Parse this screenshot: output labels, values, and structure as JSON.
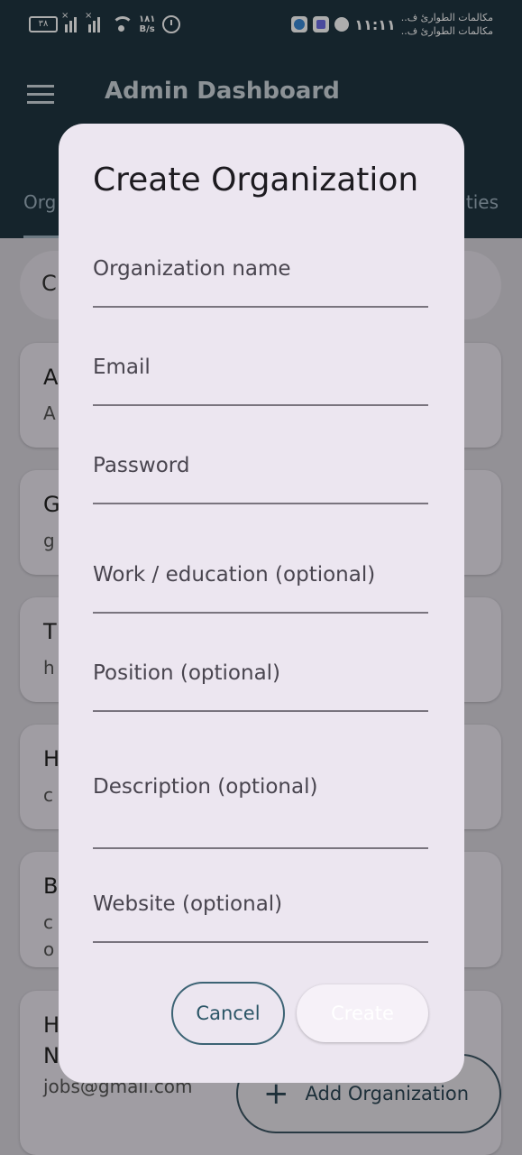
{
  "status_bar": {
    "battery": "٣٨",
    "net_speed_value": "١٨١",
    "net_speed_unit": "B/s",
    "time": "١١:١١",
    "carrier_1": "مكالمات الطوارئ ف..",
    "carrier_2": "مكالمات الطوارئ ف.."
  },
  "app_bar": {
    "title": "Admin Dashboard"
  },
  "tabs": [
    {
      "label": "Org"
    },
    {
      "label": "ties"
    }
  ],
  "background_list": {
    "search_hint_initial": "C",
    "cards": [
      {
        "title": "A",
        "subtitle": "A"
      },
      {
        "title": "G",
        "subtitle": "g"
      },
      {
        "title": "T",
        "subtitle": "h"
      },
      {
        "title": "H",
        "subtitle": "c"
      },
      {
        "title": "B",
        "subtitle": "c",
        "subtitle2": "o"
      },
      {
        "title": "H",
        "title2": "N",
        "subtitle": "jobs@gmail.com"
      }
    ]
  },
  "fab": {
    "label": "Add Organization"
  },
  "dialog": {
    "title": "Create Organization",
    "fields": {
      "organization_name": {
        "placeholder": "Organization name",
        "value": ""
      },
      "email": {
        "placeholder": "Email",
        "value": ""
      },
      "password": {
        "placeholder": "Password",
        "value": ""
      },
      "work_education": {
        "placeholder": "Work / education (optional)",
        "value": ""
      },
      "position": {
        "placeholder": "Position (optional)",
        "value": ""
      },
      "description": {
        "placeholder": "Description (optional)",
        "value": ""
      },
      "website": {
        "placeholder": "Website (optional)",
        "value": ""
      }
    },
    "cancel_label": "Cancel",
    "create_label": "Create"
  },
  "colors": {
    "app_bar": "#1f3542",
    "dialog_surface": "#ece6f0",
    "outline_button": "#3c6374"
  }
}
